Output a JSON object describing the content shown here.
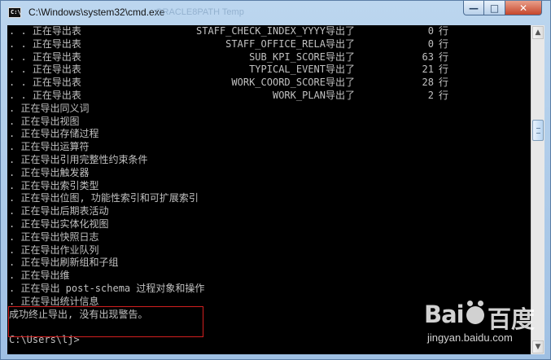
{
  "window": {
    "title": "C:\\Windows\\system32\\cmd.exe",
    "background_title": "ORACLE8PATH Temp",
    "icon": "cmd-icon",
    "controls": {
      "minimize": "—",
      "maximize": "□",
      "close": "✕"
    }
  },
  "console": {
    "table_prefix": ". . 正在导出表",
    "table_rows": [
      {
        "name": "STAFF_CHECK_INDEX_YYYY导出了",
        "count": "0",
        "unit": "行"
      },
      {
        "name": "STAFF_OFFICE_RELA导出了",
        "count": "0",
        "unit": "行"
      },
      {
        "name": "SUB_KPI_SCORE导出了",
        "count": "63",
        "unit": "行"
      },
      {
        "name": "TYPICAL_EVENT导出了",
        "count": "21",
        "unit": "行"
      },
      {
        "name": "WORK_COORD_SCORE导出了",
        "count": "28",
        "unit": "行"
      },
      {
        "name": "WORK_PLAN导出了",
        "count": "2",
        "unit": "行"
      }
    ],
    "lines": [
      ". 正在导出同义词",
      ". 正在导出视图",
      ". 正在导出存储过程",
      ". 正在导出运算符",
      ". 正在导出引用完整性约束条件",
      ". 正在导出触发器",
      ". 正在导出索引类型",
      ". 正在导出位图, 功能性索引和可扩展索引",
      ". 正在导出后期表活动",
      ". 正在导出实体化视图",
      ". 正在导出快照日志",
      ". 正在导出作业队列",
      ". 正在导出刷新组和子组",
      ". 正在导出维",
      ". 正在导出 post-schema 过程对象和操作",
      ". 正在导出统计信息",
      "成功终止导出, 没有出现警告。",
      "",
      "C:\\Users\\lj>"
    ]
  },
  "watermark": {
    "logo_left": "Bai",
    "logo_right": "百度",
    "url": "jingyan.baidu.com"
  },
  "colors": {
    "console_bg": "#000000",
    "console_text": "#c0c0c0",
    "highlight": "#d31f1f"
  }
}
